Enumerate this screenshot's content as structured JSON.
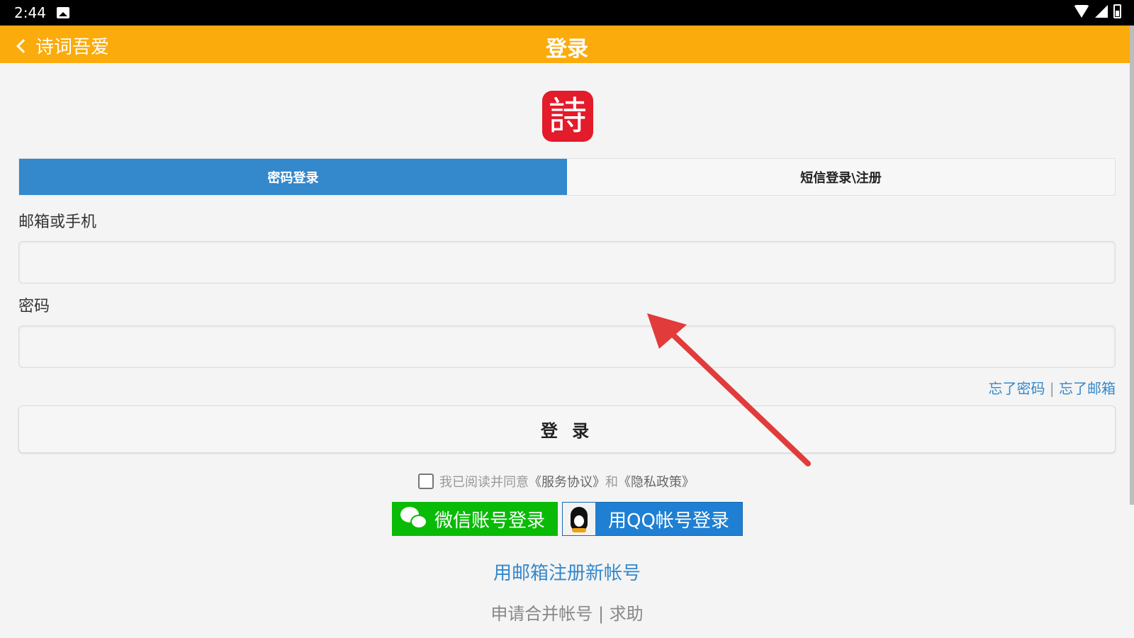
{
  "status_bar": {
    "time": "2:44"
  },
  "app_bar": {
    "back_label": "诗词吾爱",
    "title": "登录"
  },
  "logo": {
    "glyph": "詩"
  },
  "tabs": [
    {
      "label": "密码登录",
      "active": true
    },
    {
      "label": "短信登录\\注册",
      "active": false
    }
  ],
  "form": {
    "account_label": "邮箱或手机",
    "account_value": "",
    "password_label": "密码",
    "password_value": "",
    "forgot_password": "忘了密码",
    "separator": "|",
    "forgot_email": "忘了邮箱",
    "login_button": "登 录"
  },
  "agreement": {
    "prefix": "我已阅读并同意",
    "service": "《服务协议》",
    "and": "和",
    "privacy": "《隐私政策》"
  },
  "social": {
    "wechat_label": "微信账号登录",
    "qq_label": "用QQ帐号登录"
  },
  "links": {
    "register": "用邮箱注册新帐号",
    "merge": "申请合并帐号",
    "separator": "|",
    "help": "求助"
  },
  "colors": {
    "app_bar": "#fbab0b",
    "tab_active": "#3488cc",
    "logo": "#e31b2a",
    "wechat": "#09bb07",
    "qq": "#1f7fd2",
    "annotation_arrow": "#e23b3b"
  }
}
